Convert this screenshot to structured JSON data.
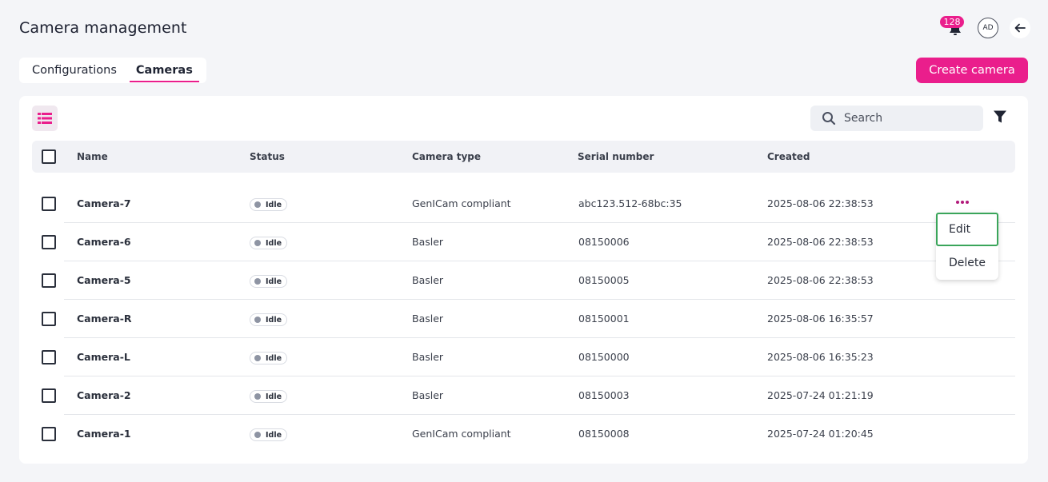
{
  "header": {
    "title": "Camera management",
    "notification_count": "128",
    "avatar_initials": "AD",
    "back_icon": "arrow-left-icon"
  },
  "tabs": [
    {
      "label": "Configurations",
      "active": false
    },
    {
      "label": "Cameras",
      "active": true
    }
  ],
  "create_button_label": "Create camera",
  "toolbar": {
    "view_icon": "list-view-icon",
    "search_placeholder": "Search",
    "filter_icon": "filter-icon"
  },
  "table": {
    "columns": [
      "Name",
      "Status",
      "Camera type",
      "Serial number",
      "Created"
    ],
    "rows": [
      {
        "name": "Camera-7",
        "status": "Idle",
        "type": "GenICam compliant",
        "serial": "abc123.512-68bc:35",
        "created": "2025-08-06 22:38:53"
      },
      {
        "name": "Camera-6",
        "status": "Idle",
        "type": "Basler",
        "serial": "08150006",
        "created": "2025-08-06 22:38:53"
      },
      {
        "name": "Camera-5",
        "status": "Idle",
        "type": "Basler",
        "serial": "08150005",
        "created": "2025-08-06 22:38:53"
      },
      {
        "name": "Camera-R",
        "status": "Idle",
        "type": "Basler",
        "serial": "08150001",
        "created": "2025-08-06 16:35:57"
      },
      {
        "name": "Camera-L",
        "status": "Idle",
        "type": "Basler",
        "serial": "08150000",
        "created": "2025-08-06 16:35:23"
      },
      {
        "name": "Camera-2",
        "status": "Idle",
        "type": "Basler",
        "serial": "08150003",
        "created": "2025-07-24 01:21:19"
      },
      {
        "name": "Camera-1",
        "status": "Idle",
        "type": "GenICam compliant",
        "serial": "08150008",
        "created": "2025-07-24 01:20:45"
      }
    ]
  },
  "context_menu": {
    "items": [
      "Edit",
      "Delete"
    ],
    "focused_item": "Edit"
  },
  "colors": {
    "accent": "#ea1e8c",
    "focus_outline": "#3aa55a",
    "status_dot": "#8e94a3"
  }
}
